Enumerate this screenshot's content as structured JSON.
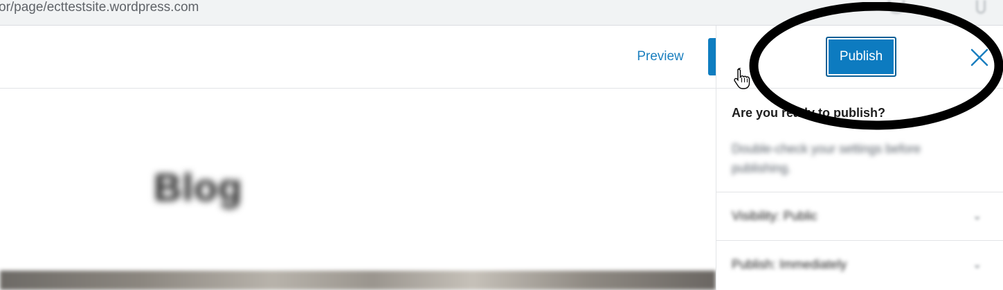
{
  "browser": {
    "url": "or/page/ecttestsite.wordpress.com",
    "icons": [
      "extension-icon",
      "menu-icon"
    ]
  },
  "editor": {
    "preview_label": "Preview",
    "page_title": "Blog"
  },
  "publish_panel": {
    "publish_label": "Publish",
    "close_icon": "close-icon",
    "heading": "Are you ready to publish?",
    "description": "Double-check your settings before publishing.",
    "rows": [
      {
        "label": "Visibility: Public",
        "icon": "chevron-down-icon"
      },
      {
        "label": "Publish: Immediately",
        "icon": "chevron-down-icon"
      }
    ]
  },
  "colors": {
    "accent": "#0d7bc0",
    "link": "#1a7fbf",
    "annotation": "#000000"
  }
}
